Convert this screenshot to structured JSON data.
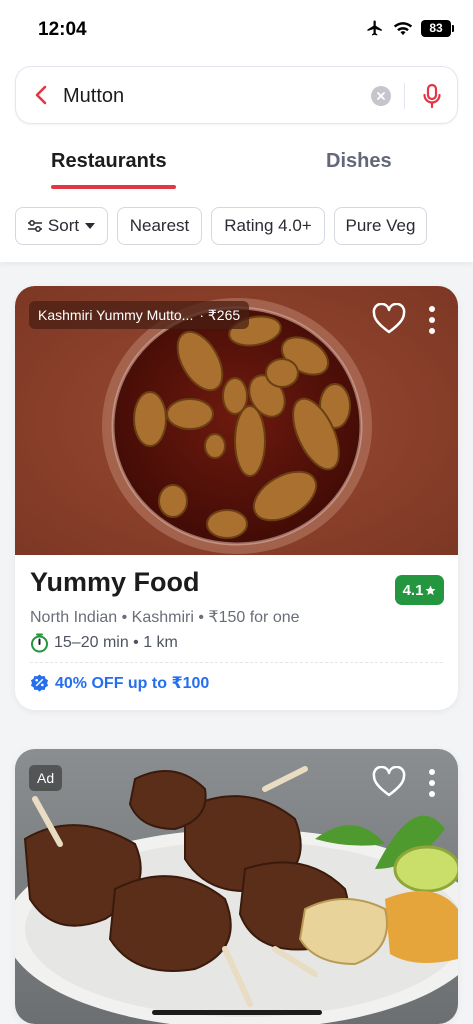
{
  "status_bar": {
    "time": "12:04",
    "battery": "83"
  },
  "search": {
    "query": "Mutton"
  },
  "tabs": [
    {
      "label": "Restaurants",
      "active": true
    },
    {
      "label": "Dishes",
      "active": false
    }
  ],
  "filters": [
    {
      "label": "Sort",
      "icon": "sliders-icon",
      "dropdown": true
    },
    {
      "label": "Nearest"
    },
    {
      "label": "Rating 4.0+"
    },
    {
      "label": "Pure Veg"
    }
  ],
  "restaurants": [
    {
      "dish_tag": "Kashmiri Yummy Mutto...",
      "dish_price": "· ₹265",
      "name": "Yummy Food",
      "rating": "4.1",
      "cuisines": "North Indian • Kashmiri • ₹150 for one",
      "eta": "15–20 min • 1 km",
      "offer": "40% OFF up to ₹100"
    },
    {
      "ad_label": "Ad"
    }
  ],
  "colors": {
    "accent": "#e23744",
    "rating_green": "#24963f",
    "offer_blue": "#256fef"
  }
}
